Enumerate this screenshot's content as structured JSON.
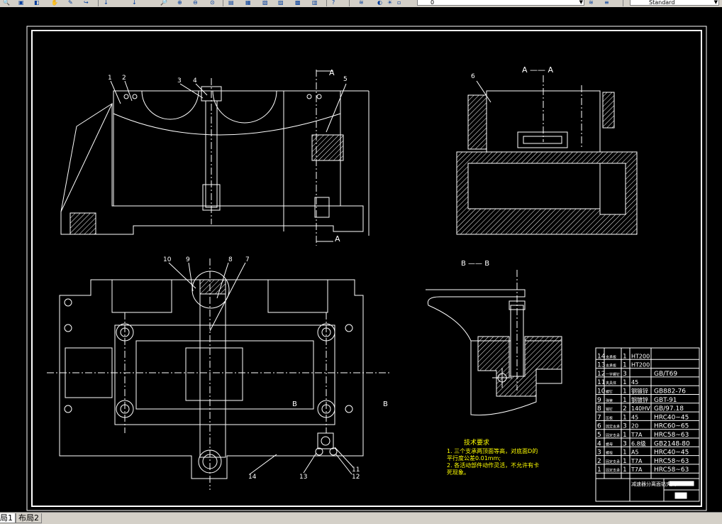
{
  "toolbar": {
    "layer_value": "0",
    "text_style_value": "Standard",
    "icons": [
      "zoom-realtime-icon",
      "zoom-window-icon",
      "zoom-previous-icon",
      "zoom-extents-icon",
      "properties-icon",
      "design-center-icon",
      "tool-palettes-icon",
      "help-icon",
      "layer-manager-icon",
      "text-style-icon"
    ]
  },
  "tabs": [
    {
      "label": "局1"
    },
    {
      "label": "布局2"
    }
  ],
  "drawing": {
    "section_a_label": "A —— A",
    "section_b_label": "B —— B",
    "cut_label_a": "A",
    "cut_label_b": "B",
    "part_numbers_top": [
      "1",
      "2",
      "3",
      "4",
      "5"
    ],
    "part_numbers_right": [
      "6"
    ],
    "part_numbers_plan": [
      "10",
      "9",
      "8",
      "7",
      "14",
      "13",
      "12",
      "11"
    ],
    "tech_title": "技术要求",
    "tech_lines": [
      "1. 三个支承两顶面等高，对底面D的",
      "平行度公差0.01mm;",
      "2. 各活动部件动作灵活，不允许有卡",
      "死现象。"
    ]
  },
  "bom": {
    "rows": [
      {
        "no": "14",
        "name": "支承板",
        "qty": "1",
        "material": "HT200",
        "note": ""
      },
      {
        "no": "13",
        "name": "支承板",
        "qty": "1",
        "material": "HT200",
        "note": ""
      },
      {
        "no": "12",
        "name": "一字螺钉",
        "qty": "3",
        "material": "",
        "note": "GB/T69"
      },
      {
        "no": "11",
        "name": "夹具体",
        "qty": "1",
        "material": "45",
        "note": ""
      },
      {
        "no": "10",
        "name": "螺钉",
        "qty": "1",
        "material": "钢镀锌",
        "note": "GB882-76"
      },
      {
        "no": "9",
        "name": "弹簧",
        "qty": "1",
        "material": "钢镀锌",
        "note": "GBT-91"
      },
      {
        "no": "8",
        "name": "销钉",
        "qty": "2",
        "material": "140HV",
        "note": "GB/97.18"
      },
      {
        "no": "7",
        "name": "压板",
        "qty": "1",
        "material": "45",
        "note": "HRC40~45"
      },
      {
        "no": "6",
        "name": "固定支承",
        "qty": "3",
        "material": "20",
        "note": "HRC60~65"
      },
      {
        "no": "5",
        "name": "固定支承",
        "qty": "1",
        "material": "T7A",
        "note": "HRC58~63"
      },
      {
        "no": "4",
        "name": "螺母",
        "qty": "3",
        "material": "6.8级",
        "note": "GB2148-80"
      },
      {
        "no": "3",
        "name": "螺栓",
        "qty": "1",
        "material": "A5",
        "note": "HRC40~45"
      },
      {
        "no": "2",
        "name": "固定支承",
        "qty": "1",
        "material": "T7A",
        "note": "HRC58~63"
      },
      {
        "no": "1",
        "name": "固定支承",
        "qty": "1",
        "material": "T7A",
        "note": "HRC58~63"
      }
    ],
    "header": {
      "c1": "序号",
      "c2": "名称",
      "c3": "数量",
      "c4": "材料",
      "c5": "备注"
    },
    "title_block": {
      "name": "减速器分离面钻夹具"
    }
  },
  "colors": {
    "line": "#ffffff",
    "text_yellow": "#ffff00",
    "hatch": "#ffffff",
    "toolbar_bg": "#d4d0c8"
  }
}
